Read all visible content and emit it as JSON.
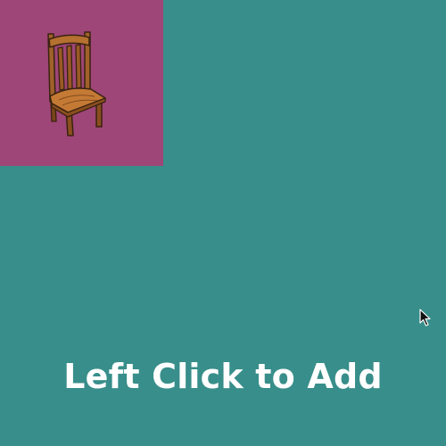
{
  "colors": {
    "background": "#388e8a",
    "tile_background": "#9e4678",
    "text": "#ffffff"
  },
  "item_tile": {
    "icon": "chair-icon"
  },
  "cursor": {
    "icon": "arrow-cursor-icon"
  },
  "instruction": {
    "text": "Left Click to Add"
  }
}
